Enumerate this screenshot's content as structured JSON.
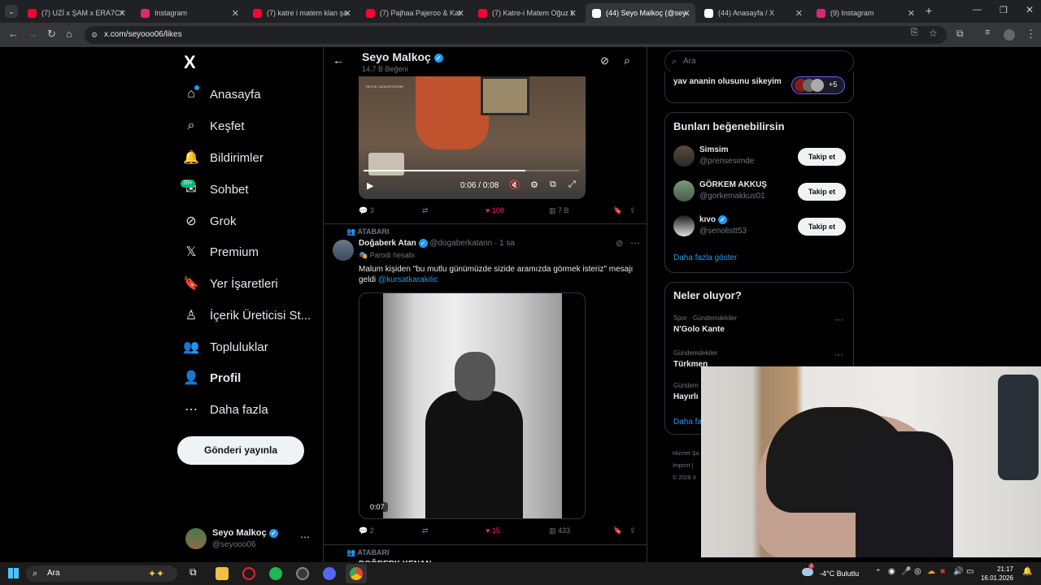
{
  "browser": {
    "tabs": [
      {
        "title": "(7) UZİ x ŞAM x ERA7CAP",
        "color": "#ff0033"
      },
      {
        "title": "Instagram",
        "color": "#d62976"
      },
      {
        "title": "(7) katre i matem klan şarkısı",
        "color": "#ff0033"
      },
      {
        "title": "(7) Pajhaa Pajeroo & Katre",
        "color": "#ff0033"
      },
      {
        "title": "(7) Katre-i Matem Oğuz C",
        "color": "#ff0033"
      },
      {
        "title": "(44) Seyo Malkoç (@seyo",
        "color": "#ffffff"
      },
      {
        "title": "(44) Anasayfa / X",
        "color": "#ffffff"
      },
      {
        "title": "(9) Instagram",
        "color": "#d62976"
      }
    ],
    "url": "x.com/seyooo06/likes"
  },
  "sidebar": {
    "logo": "X",
    "items": [
      {
        "label": "Anasayfa",
        "icon": "home-icon",
        "glyph": "⌂"
      },
      {
        "label": "Keşfet",
        "icon": "search-icon",
        "glyph": "⌕"
      },
      {
        "label": "Bildirimler",
        "icon": "bell-icon",
        "glyph": "🔔"
      },
      {
        "label": "Sohbet",
        "icon": "mail-icon",
        "glyph": "✉"
      },
      {
        "label": "Grok",
        "icon": "grok-icon",
        "glyph": "⊘"
      },
      {
        "label": "Premium",
        "icon": "x-premium-icon",
        "glyph": "𝕏"
      },
      {
        "label": "Yer İşaretleri",
        "icon": "bookmark-icon",
        "glyph": "🔖"
      },
      {
        "label": "İçerik Üreticisi St...",
        "icon": "creator-icon",
        "glyph": "♙"
      },
      {
        "label": "Topluluklar",
        "icon": "communities-icon",
        "glyph": "👥"
      },
      {
        "label": "Profil",
        "icon": "profile-icon",
        "glyph": "👤"
      },
      {
        "label": "Daha fazla",
        "icon": "more-icon",
        "glyph": "⋯"
      }
    ],
    "chat_badge": "20+",
    "post_button": "Gönderi yayınla",
    "account": {
      "name": "Seyo Malkoç",
      "handle": "@seyooo06"
    }
  },
  "profile_header": {
    "name": "Seyo Malkoç",
    "subtitle": "14,7 B Beğeni"
  },
  "tweet1": {
    "video_time": "0:06 / 0:08",
    "watermark": "TIKTOK / AZIZORTVEDIR",
    "replies": "3",
    "likes": "108",
    "views": "7 B"
  },
  "tweet2": {
    "context": "ATABARI",
    "name": "Doğaberk Atan",
    "handle": "@dogaberkatann",
    "time": "· 1 sa",
    "parody": "Parodi hesabı",
    "text": "Malum kişiden \"bu mutlu günümüzde sizide aramızda görmek isteriz\" mesajı geldi",
    "mention": "@kursatkarakilic",
    "video_duration": "0:07",
    "replies": "2",
    "likes": "15",
    "views": "433"
  },
  "tweet3": {
    "context": "ATABARI",
    "name": "DOĞBERK KENAN"
  },
  "search": {
    "placeholder": "Ara"
  },
  "community_card": {
    "text": "yav ananin olusunu sikeyim",
    "count": "+5"
  },
  "suggestions": {
    "title": "Bunları beğenebilirsin",
    "follow_label": "Takip et",
    "users": [
      {
        "name": "Simsim",
        "handle": "@prensesimde"
      },
      {
        "name": "GÖRKEM AKKUŞ",
        "handle": "@gorkemakkus01"
      },
      {
        "name": "kıvo",
        "handle": "@senolistt53"
      }
    ],
    "show_more": "Daha fazla göster"
  },
  "trends": {
    "title": "Neler oluyor?",
    "items": [
      {
        "category": "Spor · Gündemdekiler",
        "name": "N'Golo Kante"
      },
      {
        "category": "Gündemdekiler",
        "name": "Türkmen"
      },
      {
        "category": "Gündem",
        "name": "Hayırlı"
      }
    ],
    "show_more": "Daha fa"
  },
  "footer": {
    "line1": "Hizmet Şa",
    "line2": "Imprint  |",
    "line3": "© 2026 X"
  },
  "taskbar": {
    "search": "Ara",
    "weather": "-4°C  Bulutlu",
    "time": "21:17",
    "date": "16.01.2026",
    "weather_badge": "2"
  }
}
